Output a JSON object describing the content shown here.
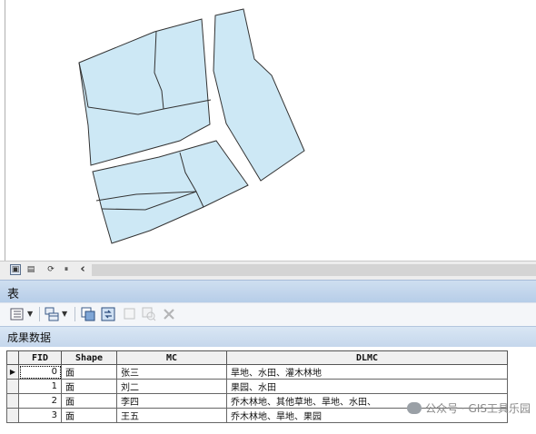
{
  "map": {
    "parcels": [
      {
        "id": 1,
        "role": "upper-left parcel"
      },
      {
        "id": 2,
        "role": "lower-left parcel"
      },
      {
        "id": 3,
        "role": "right parcel"
      }
    ]
  },
  "map_toolbar": {
    "buttons": [
      {
        "name": "data-view-icon",
        "glyph": "▣"
      },
      {
        "name": "layout-view-icon",
        "glyph": "▤"
      },
      {
        "name": "refresh-icon",
        "glyph": "⟳"
      },
      {
        "name": "pause-icon",
        "glyph": "⏸"
      },
      {
        "name": "scroll-left-icon",
        "glyph": "‹"
      }
    ]
  },
  "table_window": {
    "title": "表"
  },
  "table_toolbar": {
    "buttons": [
      {
        "name": "table-options-icon",
        "glyph": "☰",
        "dropdown": true
      },
      {
        "name": "related-tables-icon",
        "glyph": "⧉",
        "dropdown": true
      },
      {
        "name": "select-by-attributes-icon",
        "glyph": "▦"
      },
      {
        "name": "switch-selection-icon",
        "glyph": "⇄"
      },
      {
        "name": "clear-selection-icon",
        "glyph": "□",
        "disabled": true
      },
      {
        "name": "zoom-to-selected-icon",
        "glyph": "⊕",
        "disabled": true
      },
      {
        "name": "delete-selected-icon",
        "glyph": "✖",
        "disabled": true
      }
    ]
  },
  "layer_tab": {
    "label": "成果数据"
  },
  "attribute_table": {
    "columns": [
      "FID",
      "Shape",
      "MC",
      "DLMC"
    ],
    "rows": [
      {
        "fid": "0",
        "shape": "面",
        "mc": "张三",
        "dlmc": "旱地、水田、灌木林地",
        "current": true
      },
      {
        "fid": "1",
        "shape": "面",
        "mc": "刘二",
        "dlmc": "果园、水田",
        "current": false
      },
      {
        "fid": "2",
        "shape": "面",
        "mc": "李四",
        "dlmc": "乔木林地、其他草地、旱地、水田、",
        "current": false
      },
      {
        "fid": "3",
        "shape": "面",
        "mc": "王五",
        "dlmc": "乔木林地、旱地、果园",
        "current": false
      }
    ],
    "current_row_marker": "▶"
  },
  "watermark": {
    "text": "公众号 · GIS工具乐园"
  },
  "colors": {
    "parcel_fill": "#cde8f5",
    "parcel_stroke": "#333333",
    "titlebar": "#c2d5ea"
  }
}
